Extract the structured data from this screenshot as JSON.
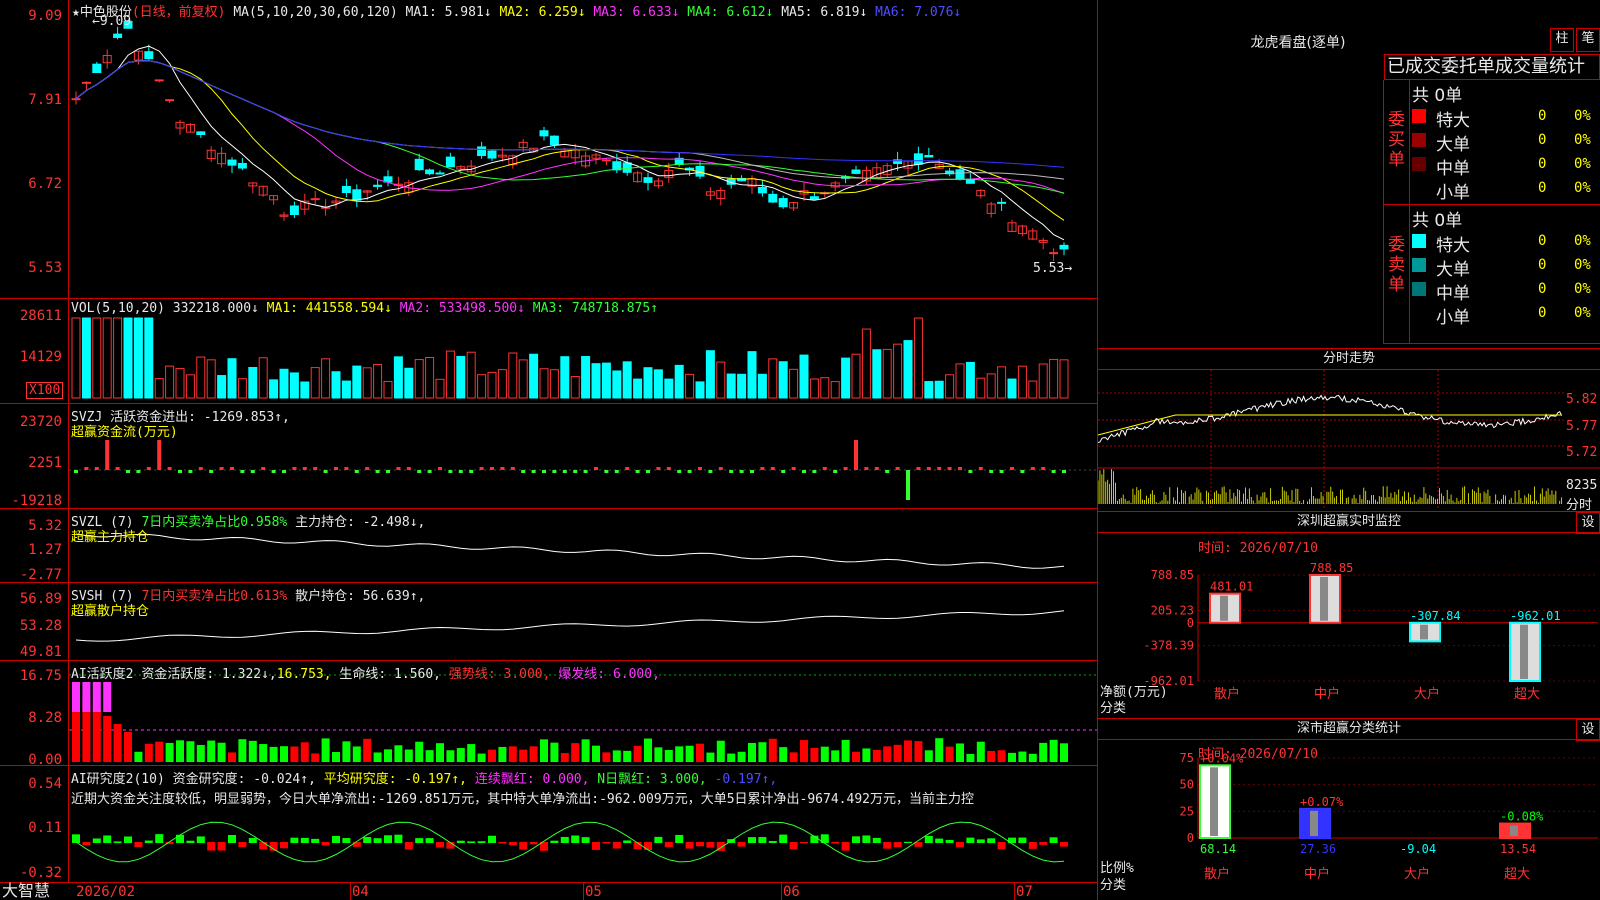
{
  "main": {
    "title": "★中色股份",
    "mode": "(日线，前复权)",
    "ma_label": "MA(5,10,20,30,60,120)",
    "ma1": "MA1: 5.981↓",
    "ma2": "MA2: 6.259↓",
    "ma3": "MA3: 6.633↓",
    "ma4": "MA4: 6.612↓",
    "ma5": "MA5: 6.819↓",
    "ma6": "MA6: 7.076↓",
    "high_marker": "9.09",
    "low_marker": "5.53",
    "y_ticks": [
      "9.09",
      "7.91",
      "6.72",
      "5.53"
    ]
  },
  "vol": {
    "label": "VOL(5,10,20)",
    "value": "332218.000↓",
    "ma1": "MA1: 441558.594↓",
    "ma2": "MA2: 533498.500↓",
    "ma3": "MA3: 748718.875↑",
    "y_ticks": [
      "28611",
      "14129"
    ],
    "unit": "X100"
  },
  "svzj": {
    "label": "SVZJ",
    "value": "活跃资金进出: -1269.853↑,",
    "subtitle": "超赢资金流(万元)",
    "y_ticks": [
      "23720",
      "2251",
      "-19218"
    ]
  },
  "svzl": {
    "label": "SVZL (7)",
    "ratio": "7日内买卖净占比0.958%",
    "value": "主力持仓: -2.498↓,",
    "subtitle": "超赢主力持仓",
    "y_ticks": [
      "5.32",
      "1.27",
      "-2.77"
    ]
  },
  "svsh": {
    "label": "SVSH (7)",
    "ratio": "7日内买卖净占比0.613%",
    "value": "散户持仓: 56.639↑,",
    "subtitle": "超赢散户持仓",
    "y_ticks": [
      "56.89",
      "53.28",
      "49.81"
    ]
  },
  "ai_active": {
    "label": "AI活跃度2",
    "value": "资金活跃度: 1.322↓,",
    "v2": "16.753,",
    "life": "生命线: 1.560,",
    "strong": "强势线: 3.000,",
    "burst": "爆发线: 6.000,",
    "y_ticks": [
      "16.75",
      "8.28",
      "0.00"
    ]
  },
  "ai_research": {
    "label": "AI研究度2(10)",
    "value": "资金研究度: -0.024↑,",
    "avg": "平均研究度: -0.197↑,",
    "cont": "连续飘红: 0.000,",
    "nday": "N日飘红: 3.000,",
    "last": "-0.197↑,",
    "comment": "近期大资金关注度较低，明显弱势，今日大单净流出:-1269.851万元，其中特大单净流出:-962.009万元，大单5日累计净出-9674.492万元，当前主力控",
    "y_ticks": [
      "0.54",
      "0.11",
      "-0.32"
    ]
  },
  "xaxis": {
    "brand": "大智慧",
    "dates": [
      "2026/02",
      "04",
      "05",
      "06",
      "07"
    ]
  },
  "dragon": {
    "title": "龙虎看盘(逐单)",
    "btn_bar": "柱",
    "btn_pen": "笔",
    "header": "已成交委托单成交量统计",
    "buy_label": "委买单",
    "sell_label": "委卖单",
    "buy_total": "共 0单",
    "sell_total": "共 0单",
    "buy_rows": [
      {
        "name": "特大",
        "count": "0",
        "pct": "0%",
        "color": "#ff0000"
      },
      {
        "name": "大单",
        "count": "0",
        "pct": "0%",
        "color": "#990000"
      },
      {
        "name": "中单",
        "count": "0",
        "pct": "0%",
        "color": "#660000"
      },
      {
        "name": "小单",
        "count": "0",
        "pct": "0%",
        "color": ""
      }
    ],
    "sell_rows": [
      {
        "name": "特大",
        "count": "0",
        "pct": "0%",
        "color": "#00ffff"
      },
      {
        "name": "大单",
        "count": "0",
        "pct": "0%",
        "color": "#009999"
      },
      {
        "name": "中单",
        "count": "0",
        "pct": "0%",
        "color": "#007777"
      },
      {
        "name": "小单",
        "count": "0",
        "pct": "0%",
        "color": ""
      }
    ]
  },
  "intraday": {
    "title": "分时走势",
    "y_ticks": [
      "5.82",
      "5.77",
      "5.72"
    ],
    "vol_value": "8235",
    "vol_unit": "分时"
  },
  "sz_monitor": {
    "title": "深圳超赢实时监控",
    "btn": "设",
    "date_label": "时间: 2026/07/10",
    "y_ticks": [
      "788.85",
      "205.23",
      "0",
      "-378.39",
      "-962.01"
    ],
    "y_label": "净额(万元)",
    "x_label": "分类",
    "categories": [
      "散户",
      "中户",
      "大户",
      "超大"
    ],
    "values": [
      481.01,
      788.85,
      -307.84,
      -962.01
    ],
    "value_labels": [
      "481.01",
      "788.85",
      "-307.84",
      "-962.01"
    ],
    "ylim": [
      -962.01,
      788.85
    ]
  },
  "sz_stats": {
    "title": "深市超赢分类统计",
    "btn": "设",
    "date_label": "时间: 2026/07/10",
    "y_ticks": [
      "75",
      "50",
      "25",
      "0"
    ],
    "y_label": "比例%",
    "x_label": "分类",
    "categories": [
      "散户",
      "中户",
      "大户",
      "超大"
    ],
    "values": [
      68.14,
      27.36,
      -9.04,
      13.54
    ],
    "value_labels": [
      "68.14",
      "27.36",
      "-9.04",
      "13.54"
    ],
    "changes": [
      "+0.04%",
      "+0.07%",
      "",
      "-0.08%"
    ],
    "colors": [
      "#ffffff",
      "#3333ff",
      "#ffffff",
      "#ff3333"
    ],
    "ylim": [
      0,
      75
    ]
  },
  "chart_data": {
    "type": "bar",
    "title": "深圳超赢实时监控",
    "categories": [
      "散户",
      "中户",
      "大户",
      "超大"
    ],
    "series": [
      {
        "name": "净额(万元)",
        "values": [
          481.01,
          788.85,
          -307.84,
          -962.01
        ]
      },
      {
        "name": "比例%",
        "values": [
          68.14,
          27.36,
          -9.04,
          13.54
        ]
      }
    ],
    "ylabel": "净额(万元)",
    "xlabel": "分类"
  }
}
